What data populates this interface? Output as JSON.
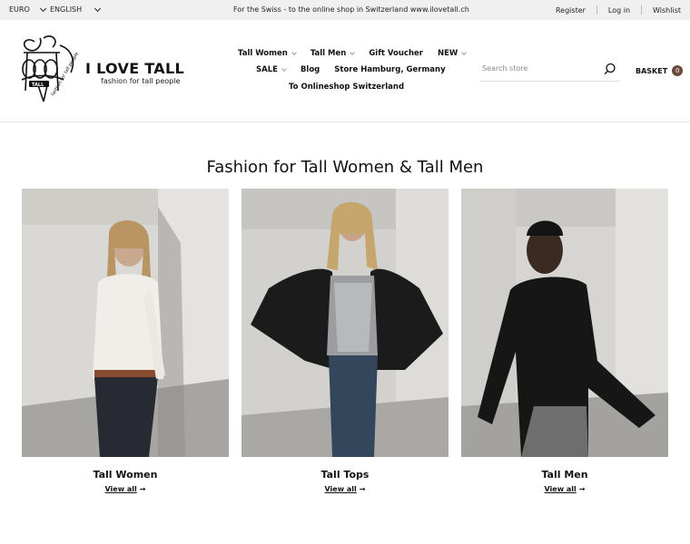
{
  "topbar": {
    "currency": "EURO",
    "language": "ENGLISH",
    "promo": "For the Swiss - to the online shop in Switzerland www.ilovetall.ch",
    "links": [
      "Register",
      "Log in",
      "Wishlist"
    ]
  },
  "header": {
    "brand": "I LOVE TALL",
    "tagline": "fashion for tall people",
    "nav_row1": [
      {
        "label": "Tall Women",
        "dropdown": true
      },
      {
        "label": "Tall Men",
        "dropdown": true
      },
      {
        "label": "Gift Voucher",
        "dropdown": false
      },
      {
        "label": "NEW",
        "dropdown": true
      }
    ],
    "nav_row2": [
      {
        "label": "SALE",
        "dropdown": true
      },
      {
        "label": "Blog",
        "dropdown": false
      },
      {
        "label": "Store Hamburg, Germany",
        "dropdown": false
      }
    ],
    "nav_row3": [
      {
        "label": "To Onlineshop Switzerland",
        "dropdown": false
      }
    ],
    "search_placeholder": "Search store",
    "basket_label": "BASKET",
    "basket_count": "0"
  },
  "main": {
    "title": "Fashion for Tall Women & Tall Men",
    "cards": [
      {
        "caption": "Tall Women",
        "link": "View all"
      },
      {
        "caption": "Tall Tops",
        "link": "View all"
      },
      {
        "caption": "Tall Men",
        "link": "View all"
      }
    ]
  },
  "colors": {
    "topbar_bg": "#f0f0f0",
    "basket_badge": "#6b4a3b"
  }
}
